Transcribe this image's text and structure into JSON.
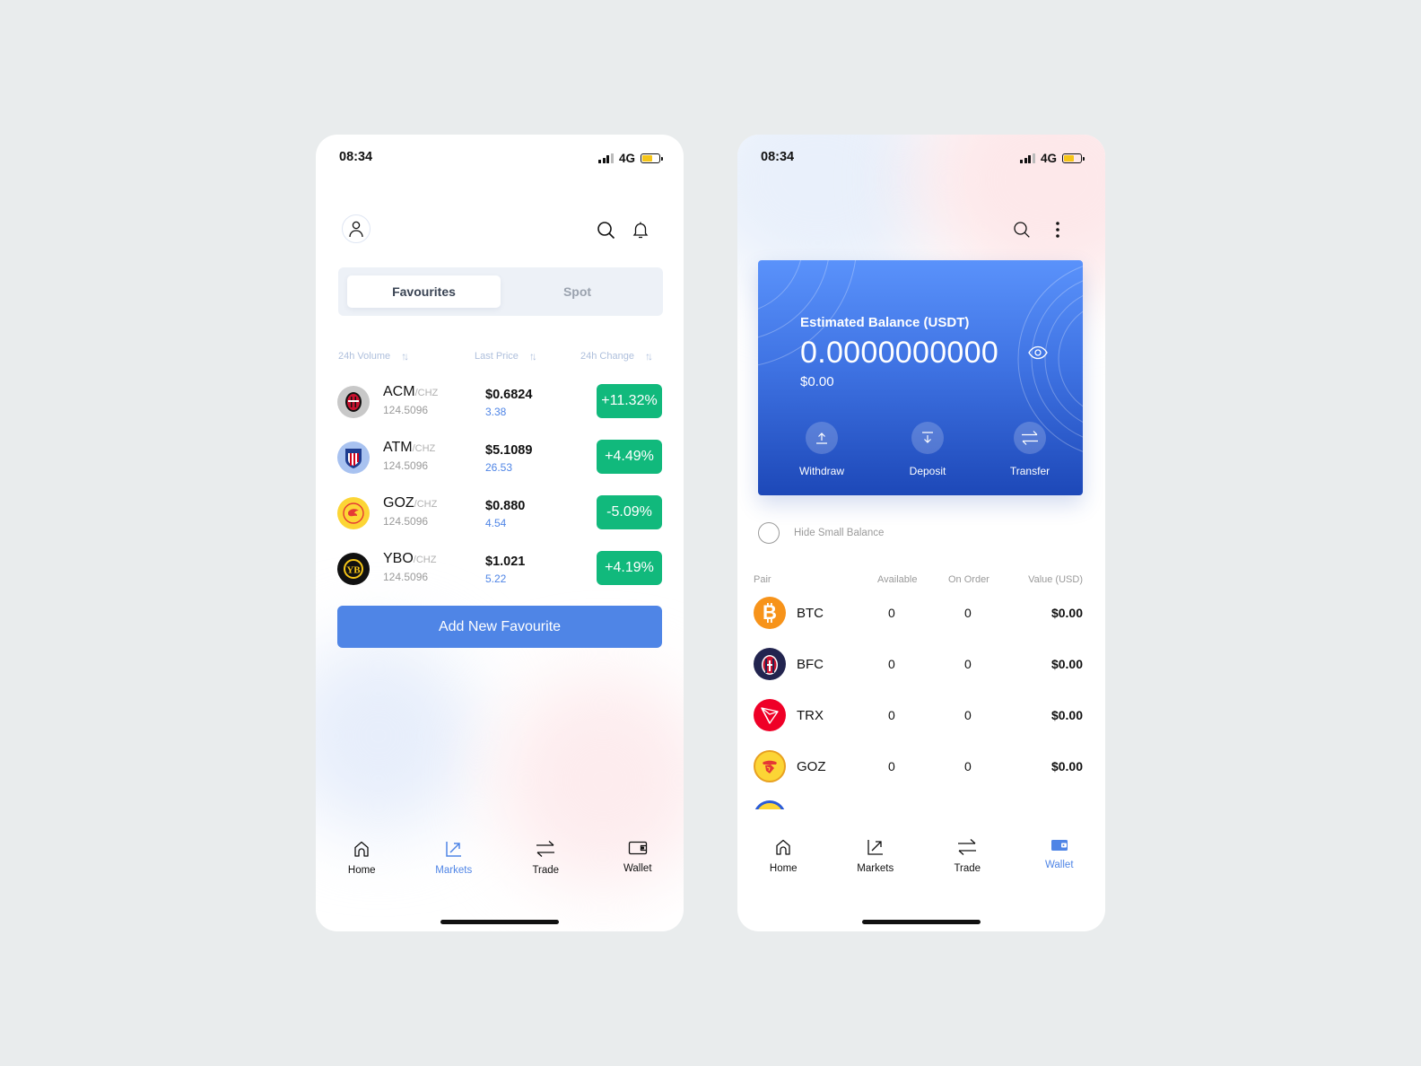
{
  "markets_screen": {
    "status": {
      "time": "08:34",
      "network": "4G",
      "battery_level": 0.6
    },
    "header": {
      "profile_icon": "user-icon",
      "search_icon": "search-icon",
      "notification_icon": "bell-icon"
    },
    "segmented": {
      "tabs": [
        {
          "label": "Favourites",
          "active": true
        },
        {
          "label": "Spot",
          "active": false
        }
      ]
    },
    "columns": [
      {
        "label": "24h Volume"
      },
      {
        "label": "Last Price"
      },
      {
        "label": "24h Change"
      }
    ],
    "favourites": [
      {
        "symbol": "ACM",
        "quote": "/CHZ",
        "volume": "124.5096",
        "price": "$0.6824",
        "sub": "3.38",
        "change": "+11.32%",
        "logo_bg": "#c8c8c8",
        "logo": "acmilan"
      },
      {
        "symbol": "ATM",
        "quote": "/CHZ",
        "volume": "124.5096",
        "price": "$5.1089",
        "sub": "26.53",
        "change": "+4.49%",
        "logo_bg": "#a8c2f0",
        "logo": "atletico"
      },
      {
        "symbol": "GOZ",
        "quote": "/CHZ",
        "volume": "124.5096",
        "price": "$0.880",
        "sub": "4.54",
        "change": "-5.09%",
        "logo_bg": "#fcd535",
        "logo": "goztepe"
      },
      {
        "symbol": "YBO",
        "quote": "/CHZ",
        "volume": "124.5096",
        "price": "$1.021",
        "sub": "5.22",
        "change": "+4.19%",
        "logo_bg": "#111111",
        "logo": "youngboys"
      }
    ],
    "add_button": "Add New Favourite",
    "tabbar": [
      {
        "label": "Home",
        "icon": "home-icon",
        "active": false
      },
      {
        "label": "Markets",
        "icon": "markets-icon",
        "active": true
      },
      {
        "label": "Trade",
        "icon": "trade-icon",
        "active": false
      },
      {
        "label": "Wallet",
        "icon": "wallet-icon",
        "active": false
      }
    ]
  },
  "wallet_screen": {
    "status": {
      "time": "08:34",
      "network": "4G",
      "battery_level": 0.6
    },
    "header": {
      "search_icon": "search-icon",
      "more_icon": "more-vertical-icon"
    },
    "balance_card": {
      "title": "Estimated Balance (USDT)",
      "amount": "0.0000000000",
      "usd": "$0.00",
      "actions": [
        {
          "label": "Withdraw",
          "icon": "upload-icon"
        },
        {
          "label": "Deposit",
          "icon": "download-icon"
        },
        {
          "label": "Transfer",
          "icon": "transfer-icon"
        }
      ]
    },
    "hide_small_balance": {
      "label": "Hide Small Balance",
      "checked": false
    },
    "table": {
      "headers": {
        "pair": "Pair",
        "available": "Available",
        "on_order": "On Order",
        "value": "Value (USD)"
      },
      "rows": [
        {
          "symbol": "BTC",
          "available": "0",
          "on_order": "0",
          "value": "$0.00",
          "logo": "bitcoin"
        },
        {
          "symbol": "BFC",
          "available": "0",
          "on_order": "0",
          "value": "$0.00",
          "logo": "bologna"
        },
        {
          "symbol": "TRX",
          "available": "0",
          "on_order": "0",
          "value": "$0.00",
          "logo": "tron"
        },
        {
          "symbol": "GOZ",
          "available": "0",
          "on_order": "0",
          "value": "$0.00",
          "logo": "goztepe"
        }
      ]
    },
    "tabbar": [
      {
        "label": "Home",
        "icon": "home-icon",
        "active": false
      },
      {
        "label": "Markets",
        "icon": "markets-icon",
        "active": false
      },
      {
        "label": "Trade",
        "icon": "trade-icon",
        "active": false
      },
      {
        "label": "Wallet",
        "icon": "wallet-icon",
        "active": true
      }
    ]
  },
  "colors": {
    "accent_blue": "#4f85e6",
    "positive_green": "#11b97c",
    "battery_yellow": "#f5c518"
  }
}
